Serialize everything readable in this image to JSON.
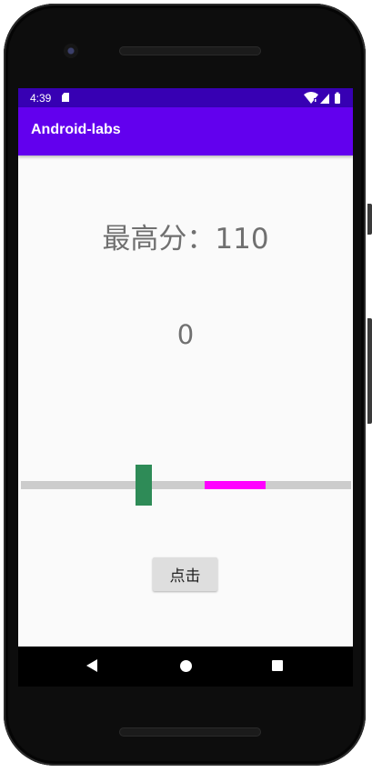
{
  "status_bar": {
    "time": "4:39",
    "icons": [
      "sd-card-icon",
      "wifi-icon",
      "signal-icon",
      "battery-icon"
    ]
  },
  "app_bar": {
    "title": "Android-labs"
  },
  "game": {
    "high_score_label": "最高分：110",
    "score": "0",
    "click_button": "点击"
  },
  "colors": {
    "status_bar": "#3700b3",
    "app_bar": "#6200ee",
    "track": "#cccccc",
    "target_zone": "#ff00ff",
    "marker": "#2e8b57"
  },
  "nav_bar": {
    "icons": [
      "back-icon",
      "home-icon",
      "recents-icon"
    ]
  }
}
